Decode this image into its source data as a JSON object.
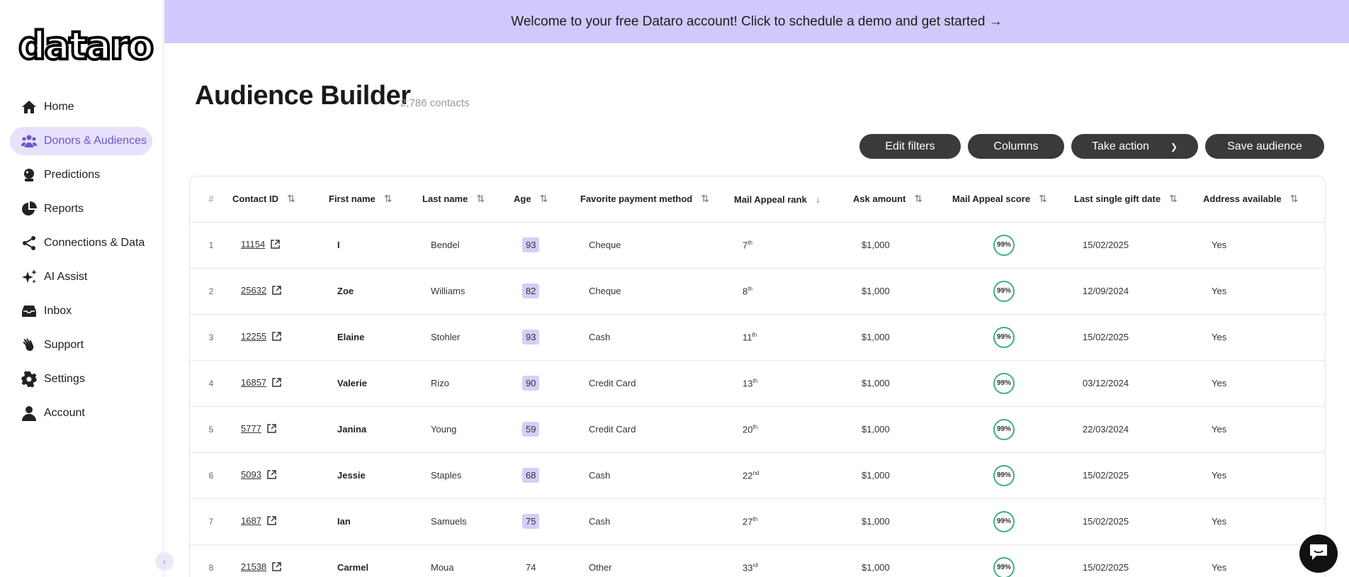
{
  "brand": {
    "logo_text": "dataro"
  },
  "sidebar": {
    "items": [
      {
        "label": "Home",
        "icon": "home-icon"
      },
      {
        "label": "Donors & Audiences",
        "icon": "people-icon",
        "active": true
      },
      {
        "label": "Predictions",
        "icon": "crystal-ball-icon"
      },
      {
        "label": "Reports",
        "icon": "pie-chart-icon"
      },
      {
        "label": "Connections & Data",
        "icon": "share-icon"
      },
      {
        "label": "AI Assist",
        "icon": "sparkle-icon"
      },
      {
        "label": "Inbox",
        "icon": "inbox-icon"
      },
      {
        "label": "Support",
        "icon": "hand-wave-icon"
      },
      {
        "label": "Settings",
        "icon": "gear-icon"
      },
      {
        "label": "Account",
        "icon": "user-icon"
      }
    ]
  },
  "banner": {
    "text": "Welcome to your free Dataro account! Click to schedule a demo and get started →"
  },
  "header": {
    "title": "Audience Builder",
    "count": "2,786 contacts"
  },
  "toolbar": {
    "edit_filters": "Edit filters",
    "columns": "Columns",
    "take_action": "Take action",
    "save_audience": "Save audience"
  },
  "table": {
    "columns": [
      "#",
      "Contact ID",
      "First name",
      "Last name",
      "Age",
      "Favorite payment method",
      "Mail Appeal rank",
      "Ask amount",
      "Mail Appeal score",
      "Last single gift date",
      "Address available"
    ],
    "rows": [
      {
        "n": "1",
        "id": "11154",
        "first": "I",
        "last": "Bendel",
        "age": "93",
        "age_badge": true,
        "payment": "Cheque",
        "rank": "7",
        "rank_suffix": "th",
        "ask": "$1,000",
        "score": "99%",
        "gift_date": "15/02/2025",
        "address": "Yes"
      },
      {
        "n": "2",
        "id": "25632",
        "first": "Zoe",
        "last": "Williams",
        "age": "82",
        "age_badge": true,
        "payment": "Cheque",
        "rank": "8",
        "rank_suffix": "th",
        "ask": "$1,000",
        "score": "99%",
        "gift_date": "12/09/2024",
        "address": "Yes"
      },
      {
        "n": "3",
        "id": "12255",
        "first": "Elaine",
        "last": "Stohler",
        "age": "93",
        "age_badge": true,
        "payment": "Cash",
        "rank": "11",
        "rank_suffix": "th",
        "ask": "$1,000",
        "score": "99%",
        "gift_date": "15/02/2025",
        "address": "Yes"
      },
      {
        "n": "4",
        "id": "16857",
        "first": "Valerie",
        "last": "Rizo",
        "age": "90",
        "age_badge": true,
        "payment": "Credit Card",
        "rank": "13",
        "rank_suffix": "th",
        "ask": "$1,000",
        "score": "99%",
        "gift_date": "03/12/2024",
        "address": "Yes"
      },
      {
        "n": "5",
        "id": "5777",
        "first": "Janina",
        "last": "Young",
        "age": "59",
        "age_badge": true,
        "payment": "Credit Card",
        "rank": "20",
        "rank_suffix": "th",
        "ask": "$1,000",
        "score": "99%",
        "gift_date": "22/03/2024",
        "address": "Yes"
      },
      {
        "n": "6",
        "id": "5093",
        "first": "Jessie",
        "last": "Staples",
        "age": "68",
        "age_badge": true,
        "payment": "Cash",
        "rank": "22",
        "rank_suffix": "nd",
        "ask": "$1,000",
        "score": "99%",
        "gift_date": "15/02/2025",
        "address": "Yes"
      },
      {
        "n": "7",
        "id": "1687",
        "first": "Ian",
        "last": "Samuels",
        "age": "75",
        "age_badge": true,
        "payment": "Cash",
        "rank": "27",
        "rank_suffix": "th",
        "ask": "$1,000",
        "score": "99%",
        "gift_date": "15/02/2025",
        "address": "Yes"
      },
      {
        "n": "8",
        "id": "21538",
        "first": "Carmel",
        "last": "Moua",
        "age": "74",
        "age_badge": false,
        "payment": "Other",
        "rank": "33",
        "rank_suffix": "rd",
        "ask": "$1,000",
        "score": "99%",
        "gift_date": "15/02/2025",
        "address": "Yes"
      }
    ]
  },
  "colors": {
    "accent": "#d2c8fb",
    "active_nav": "#e7e1fb",
    "score_ring": "#3fae8c",
    "button": "#3a3a3a"
  }
}
